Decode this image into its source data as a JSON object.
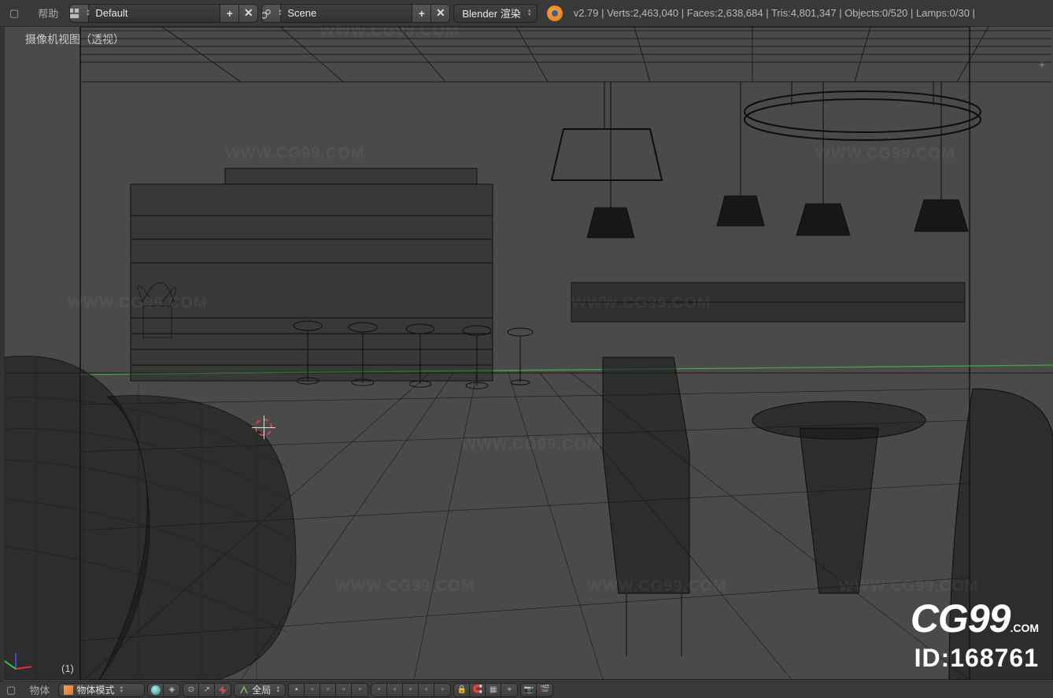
{
  "top": {
    "help_menu": "帮助",
    "layout": {
      "icon": "screen-layout-icon",
      "value": "Default",
      "plus": "+",
      "close": "✕"
    },
    "scene": {
      "icon": "scene-icon",
      "value": "Scene",
      "plus": "+",
      "close": "✕"
    },
    "engine_label": "Blender 渲染",
    "stats": "v2.79 | Verts:2,463,040 | Faces:2,638,684 | Tris:4,801,347 | Objects:0/520 | Lamps:0/30 | ",
    "stats_parsed": {
      "version": "v2.79",
      "verts": "2,463,040",
      "faces": "2,638,684",
      "tris": "4,801,347",
      "objects": "0/520",
      "lamps": "0/30"
    }
  },
  "viewport": {
    "label": "摄像机视图（透视）",
    "frame": "(1)"
  },
  "bottom": {
    "menu_object": "物体",
    "mode_label": "物体模式",
    "layers_label": "全局"
  },
  "watermark": {
    "text": "WWW.CG99.COM",
    "logo_main": "CG99",
    "logo_sub": ".COM",
    "id_label": "ID:168761"
  }
}
